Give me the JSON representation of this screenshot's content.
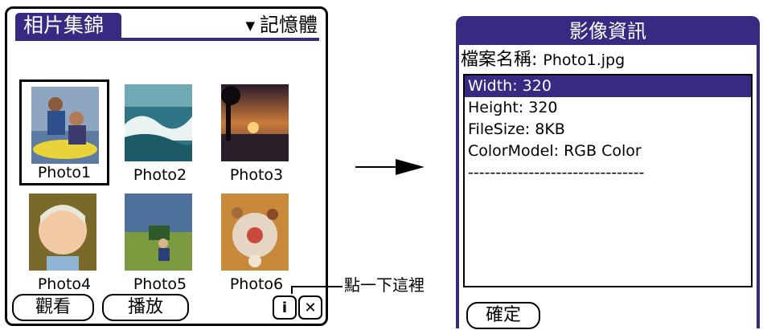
{
  "left": {
    "app_title": "相片集錦",
    "category": "記憶體",
    "photos": [
      {
        "caption": "Photo1",
        "selected": true
      },
      {
        "caption": "Photo2",
        "selected": false
      },
      {
        "caption": "Photo3",
        "selected": false
      },
      {
        "caption": "Photo4",
        "selected": false
      },
      {
        "caption": "Photo5",
        "selected": false
      },
      {
        "caption": "Photo6",
        "selected": false
      }
    ],
    "buttons": {
      "view_label": "觀看",
      "play_label": "播放",
      "info_icon": "info-icon",
      "close_icon": "close-icon"
    }
  },
  "callout": {
    "text": "點一下這裡"
  },
  "dialog": {
    "title": "影像資訊",
    "filename_label": "檔案名稱:",
    "filename_value": "Photo1.jpg",
    "rows": [
      "Width: 320",
      "Height: 320",
      "FileSize: 8KB",
      "ColorModel: RGB Color",
      "--------------------------------"
    ],
    "ok_label": "確定"
  },
  "colors": {
    "accent": "#362a82",
    "background": "#ffffff"
  }
}
